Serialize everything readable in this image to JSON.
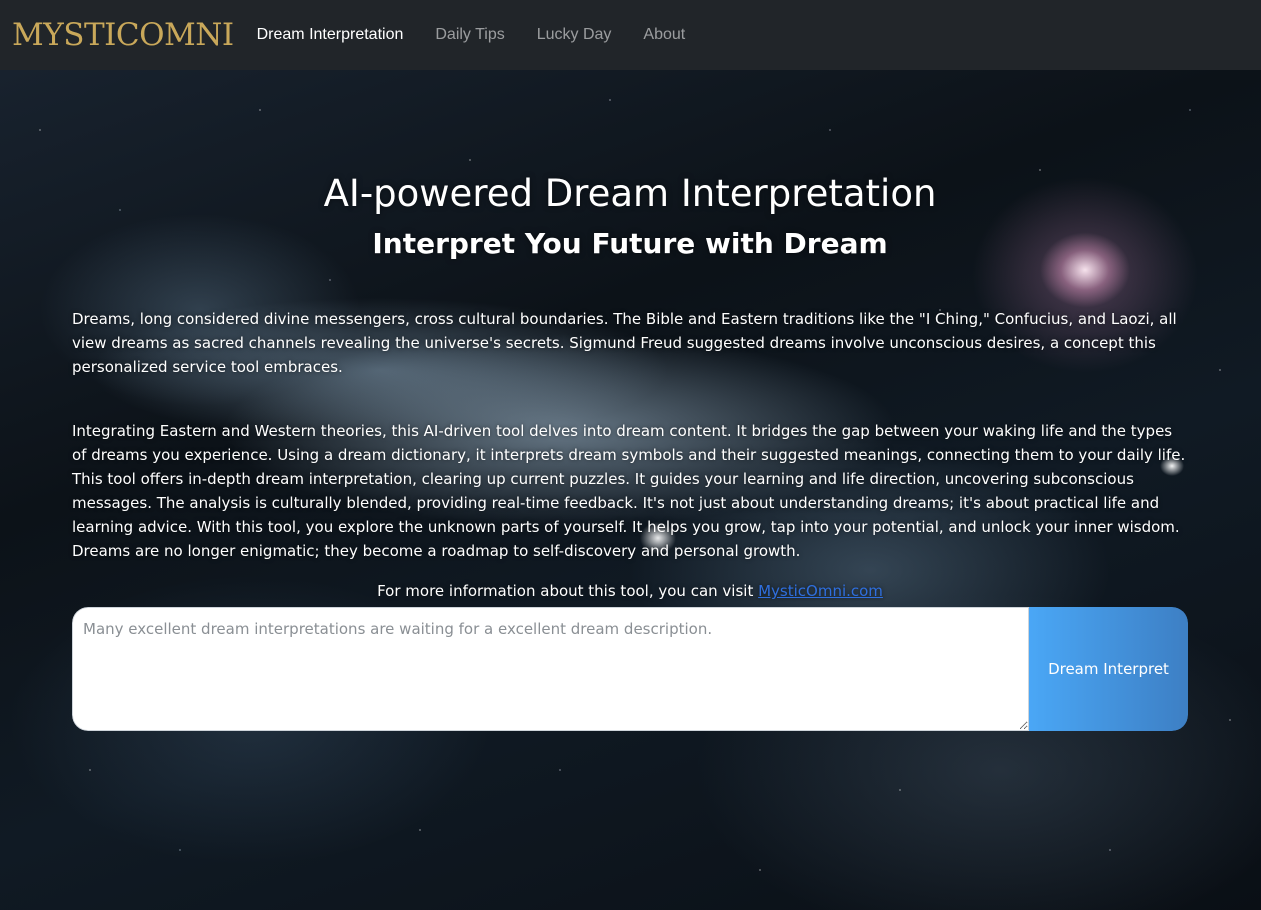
{
  "navbar": {
    "brand": "MYSTICOMNI",
    "links": [
      {
        "label": "Dream Interpretation",
        "active": true
      },
      {
        "label": "Daily Tips",
        "active": false
      },
      {
        "label": "Lucky Day",
        "active": false
      },
      {
        "label": "About",
        "active": false
      }
    ]
  },
  "main": {
    "title": "AI-powered Dream Interpretation",
    "subtitle": "Interpret You Future with Dream",
    "paragraph1": "Dreams, long considered divine messengers, cross cultural boundaries. The Bible and Eastern traditions like the \"I Ching,\" Confucius, and Laozi, all view dreams as sacred channels revealing the universe's secrets. Sigmund Freud suggested dreams involve unconscious desires, a concept this personalized service tool embraces.",
    "paragraph2": "Integrating Eastern and Western theories, this AI-driven tool delves into dream content. It bridges the gap between your waking life and the types of dreams you experience. Using a dream dictionary, it interprets dream symbols and their suggested meanings, connecting them to your daily life. This tool offers in-depth dream interpretation, clearing up current puzzles. It guides your learning and life direction, uncovering subconscious messages. The analysis is culturally blended, providing real-time feedback. It's not just about understanding dreams; it's about practical life and learning advice. With this tool, you explore the unknown parts of yourself. It helps you grow, tap into your potential, and unlock your inner wisdom. Dreams are no longer enigmatic; they become a roadmap to self-discovery and personal growth.",
    "more_info_text": "For more information about this tool, you can visit ",
    "more_info_link": "MysticOmni.com"
  },
  "form": {
    "input_value": "",
    "input_placeholder": "Many excellent dream interpretations are waiting for a excellent dream description.",
    "button_label": "Dream Interpret"
  },
  "colors": {
    "navbar_bg": "#212529",
    "brand_gold": "#c9a85a",
    "link_blue": "#2f6fde",
    "button_gradient_start": "#4aa7f6",
    "button_gradient_end": "#3d7fc4"
  }
}
